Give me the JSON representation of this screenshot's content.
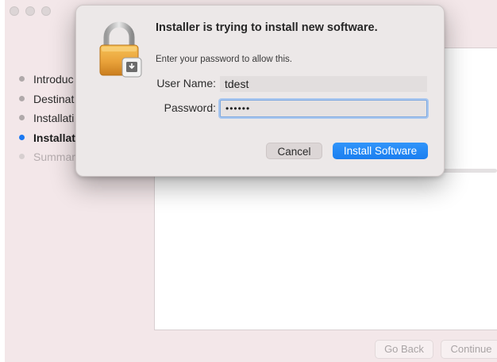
{
  "window": {
    "sidebar": {
      "steps": [
        {
          "label": "Introduc",
          "state": "done"
        },
        {
          "label": "Destinat",
          "state": "done"
        },
        {
          "label": "Installati",
          "state": "done"
        },
        {
          "label": "Installat",
          "state": "active"
        },
        {
          "label": "Summar",
          "state": "pending"
        }
      ]
    },
    "buttons": {
      "go_back": "Go Back",
      "continue": "Continue"
    }
  },
  "dialog": {
    "title": "Installer is trying to install new software.",
    "message": "Enter your password to allow this.",
    "username_label": "User Name:",
    "username_value": "tdest",
    "password_label": "Password:",
    "password_value": "••••••",
    "cancel_label": "Cancel",
    "install_label": "Install Software",
    "icon": "lock-icon"
  },
  "colors": {
    "accent": "#1f86f6",
    "active_step_dot": "#1a78f2"
  }
}
